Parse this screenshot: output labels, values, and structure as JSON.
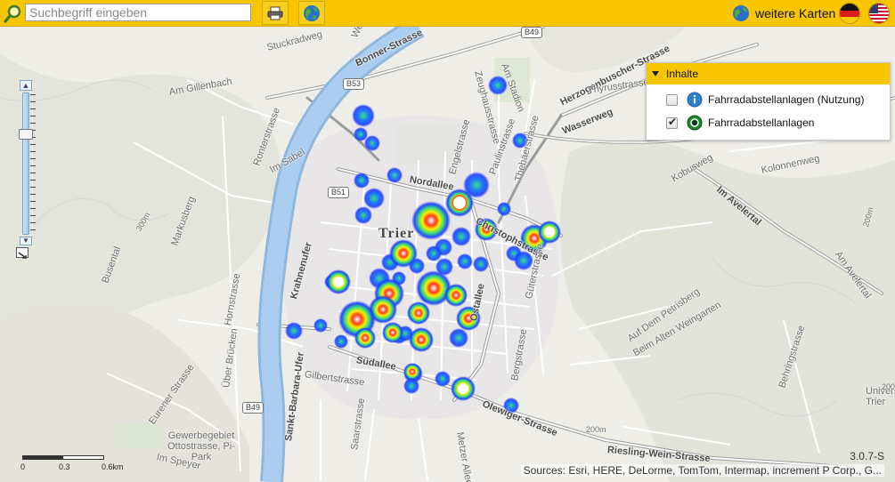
{
  "toolbar": {
    "search_placeholder": "Suchbegriff eingeben",
    "print_icon": "printer-icon",
    "globe_icon": "globe-icon",
    "more_maps_label": "weitere Karten",
    "flags": [
      "flag-germany",
      "flag-usa"
    ]
  },
  "layers": {
    "header": "Inhalte",
    "items": [
      {
        "label": "Fahrradabstellanlagen (Nutzung)",
        "checked": false,
        "icon": "info-icon"
      },
      {
        "label": "Fahrradabstellanlagen",
        "checked": true,
        "icon": "green-circle-icon"
      }
    ]
  },
  "map": {
    "city": "Trier",
    "labels": [
      "Stuckradweg",
      "Bonner-Strasse",
      "Weisse",
      "Am Stadion",
      "Zeughausstrasse",
      "Herzogenbuscher-Strasse",
      "Thyrusstrasse",
      "Wasserweg",
      "Am Gillenbach",
      "Ronterstrasse",
      "Im Sabel",
      "Nordallee",
      "Engelstrasse",
      "Paulinstrasse",
      "Thebäerstrasse",
      "Kobusweg",
      "Im Avelertal",
      "Kolonnenweg",
      "Markusberg",
      "Busental",
      "Krahnenufer",
      "Christophstrasse",
      "Hornstrasse",
      "Güterstrasse",
      "Ostallee",
      "Südallee",
      "Gilbertstrasse",
      "Saarstrasse",
      "Bergstrasse",
      "Auf Dem Petrisberg",
      "Beim Alten Weingarten",
      "Behringstrasse",
      "Am Avelertal",
      "Sankt-Barbara-Ufer",
      "Über Brücken",
      "Eurener Strasse",
      "Gewerbegebiet Ottostrasse, Pi-Park",
      "Im Speyer",
      "Olewiger-Strasse",
      "Metzer Allee",
      "Riesling-Wein-Strasse",
      "Universität Trier"
    ],
    "shields": [
      "B53",
      "B49",
      "B51",
      "B49"
    ],
    "contours": [
      "300m",
      "200m",
      "200m",
      "200m",
      "200m"
    ]
  },
  "scale": {
    "ticks": [
      "0",
      "0.3",
      "0.6km"
    ]
  },
  "version": "3.0.7-S",
  "attribution": "Sources: Esri, HERE, DeLorme, TomTom, Intermap, increment P Corp., G..."
}
